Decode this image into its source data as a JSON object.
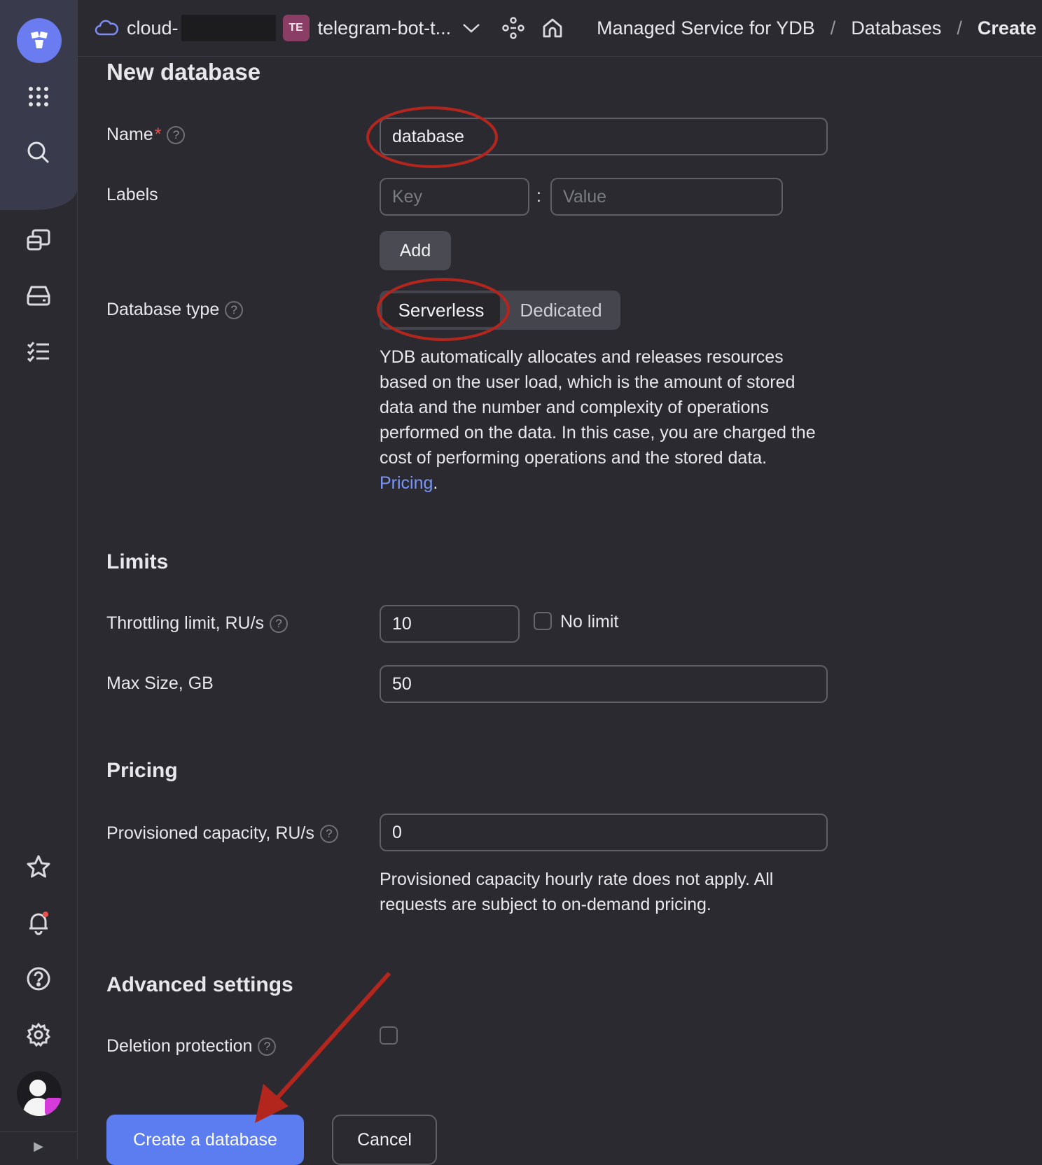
{
  "header": {
    "cloud_name": "cloud-",
    "folder_badge": "TE",
    "folder_name": "telegram-bot-t...",
    "breadcrumbs": [
      "Managed Service for YDB",
      "Databases",
      "Create"
    ],
    "separator": "/"
  },
  "sidebar": {
    "icons": [
      "grid-icon",
      "search-icon",
      "database-icon",
      "storage-icon",
      "tasks-icon",
      "star-icon",
      "bell-icon",
      "help-icon",
      "gear-icon"
    ],
    "expand": "▶"
  },
  "form": {
    "title": "New database",
    "name": {
      "label": "Name",
      "required_mark": "*",
      "value": "database"
    },
    "labels": {
      "label": "Labels",
      "key_placeholder": "Key",
      "value_placeholder": "Value",
      "colon": ":",
      "add_button": "Add"
    },
    "database_type": {
      "label": "Database type",
      "options": [
        "Serverless",
        "Dedicated"
      ],
      "selected": "Serverless",
      "description": "YDB automatically allocates and releases resources based on the user load, which is the amount of stored data and the number and complexity of operations performed on the data. In this case, you are charged the cost of performing operations and the stored data.",
      "pricing_link": "Pricing",
      "pricing_period": "."
    },
    "limits": {
      "title": "Limits",
      "throttling_label": "Throttling limit, RU/s",
      "throttling_value": "10",
      "no_limit_label": "No limit",
      "max_size_label": "Max Size, GB",
      "max_size_value": "50"
    },
    "pricing": {
      "title": "Pricing",
      "provisioned_label": "Provisioned capacity, RU/s",
      "provisioned_value": "0",
      "note": "Provisioned capacity hourly rate does not apply. All requests are subject to on-demand pricing."
    },
    "advanced": {
      "title": "Advanced settings",
      "deletion_protection_label": "Deletion protection"
    },
    "help_mark": "?",
    "create_button": "Create a database",
    "cancel_button": "Cancel"
  },
  "colors": {
    "accent": "#5c7df0",
    "annotation": "#b3261e",
    "link": "#7a95f5"
  }
}
